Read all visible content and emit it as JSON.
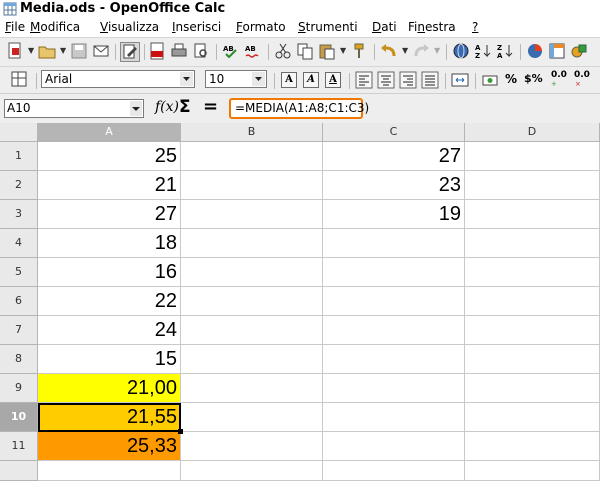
{
  "window": {
    "title": "Media.ods - OpenOffice Calc"
  },
  "menu": [
    {
      "label": "File",
      "ul": "F",
      "rest": "ile"
    },
    {
      "label": "Modifica",
      "ul": "M",
      "rest": "odifica"
    },
    {
      "label": "Visualizza",
      "ul": "V",
      "rest": "isualizza"
    },
    {
      "label": "Inserisci",
      "ul": "I",
      "rest": "nserisci"
    },
    {
      "label": "Formato",
      "ul": "F",
      "rest": "ormato"
    },
    {
      "label": "Strumenti",
      "ul": "S",
      "rest": "trumenti"
    },
    {
      "label": "Dati",
      "ul": "D",
      "rest": "ati"
    },
    {
      "label": "Finestra",
      "pre": "Fi",
      "ul": "n",
      "rest": "estra"
    },
    {
      "label": "?",
      "ul": "?",
      "rest": ""
    }
  ],
  "formatting": {
    "font_name": "Arial",
    "font_size": "10",
    "bold_label": "A",
    "italic_label": "A",
    "underline_label": "A",
    "percent_label": "%",
    "currency_label": "$%",
    "decimal_add_label": "0.0",
    "decimal_remove_label": "0.0"
  },
  "formula_bar": {
    "cell_reference": "A10",
    "fx_label": "f(x)",
    "sum_label": "Σ",
    "equals_label": "=",
    "formula": "=MEDIA(A1:A8;C1:C3)"
  },
  "sheet": {
    "columns": [
      "A",
      "B",
      "C",
      "D"
    ],
    "selected_column": "A",
    "selected_row": "10",
    "rows": [
      {
        "n": "1",
        "A": "25",
        "B": "",
        "C": "27",
        "D": ""
      },
      {
        "n": "2",
        "A": "21",
        "B": "",
        "C": "23",
        "D": ""
      },
      {
        "n": "3",
        "A": "27",
        "B": "",
        "C": "19",
        "D": ""
      },
      {
        "n": "4",
        "A": "18",
        "B": "",
        "C": "",
        "D": ""
      },
      {
        "n": "5",
        "A": "16",
        "B": "",
        "C": "",
        "D": ""
      },
      {
        "n": "6",
        "A": "22",
        "B": "",
        "C": "",
        "D": ""
      },
      {
        "n": "7",
        "A": "24",
        "B": "",
        "C": "",
        "D": ""
      },
      {
        "n": "8",
        "A": "15",
        "B": "",
        "C": "",
        "D": ""
      },
      {
        "n": "9",
        "A": "21,00",
        "B": "",
        "C": "",
        "D": "",
        "fillA": "#ffff00"
      },
      {
        "n": "10",
        "A": "21,55",
        "B": "",
        "C": "",
        "D": "",
        "fillA": "#ffcc00"
      },
      {
        "n": "11",
        "A": "25,33",
        "B": "",
        "C": "",
        "D": "",
        "fillA": "#ff9900"
      }
    ]
  },
  "colors": {
    "formula_border": "#f07800",
    "active_cell_border": "#000000"
  }
}
